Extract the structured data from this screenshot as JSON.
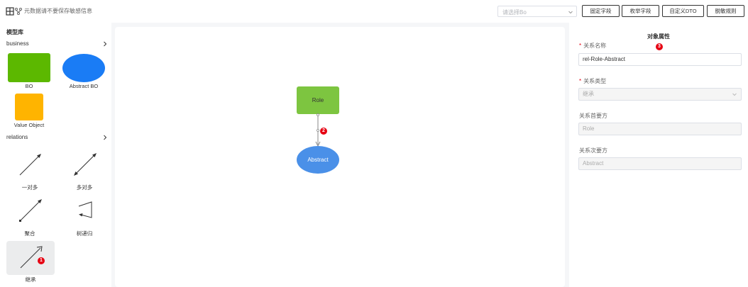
{
  "toolbar": {
    "notice": "元数据请不要保存敏感信息",
    "bo_select_placeholder": "请选择Bo",
    "buttons": [
      "固定字段",
      "枚举字段",
      "自定义DTO",
      "脱敏规则"
    ]
  },
  "palette": {
    "title": "模型库",
    "business_label": "business",
    "business_items": [
      "BO",
      "Abstract BO",
      "Value Object"
    ],
    "relations_label": "relations",
    "relation_items": [
      "一对多",
      "多对多",
      "聚合",
      "树递归",
      "继承"
    ],
    "colors": {
      "bo": "#5cb800",
      "abstract_bo": "#1a7cf5",
      "value_object": "#ffb400"
    }
  },
  "canvas": {
    "nodes": [
      "Role",
      "Abstract"
    ],
    "colors": {
      "role": "#7dc540",
      "abstract": "#4a90e8"
    }
  },
  "badges": {
    "palette": "1",
    "canvas": "2",
    "properties": "3"
  },
  "properties": {
    "title": "对象属性",
    "name_label": "关系名称",
    "name_value": "rel-Role-Abstract",
    "type_label": "关系类型",
    "type_value": "继承",
    "primary_label": "关系首要方",
    "primary_value": "Role",
    "secondary_label": "关系次要方",
    "secondary_value": "Abstract"
  }
}
